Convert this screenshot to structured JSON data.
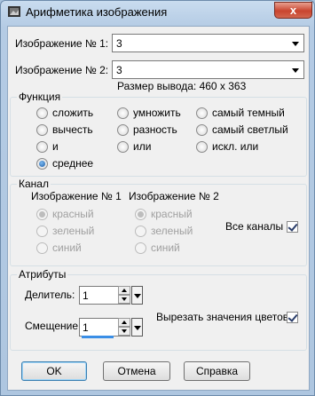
{
  "window": {
    "title": "Арифметика изображения",
    "close_glyph": "x"
  },
  "image1": {
    "label": "Изображение № 1:",
    "value": "3"
  },
  "image2": {
    "label": "Изображение № 2:",
    "value": "3"
  },
  "output_size": "Размер вывода: 460 x 363",
  "function": {
    "title": "Функция",
    "options": [
      {
        "label": "сложить",
        "selected": false
      },
      {
        "label": "умножить",
        "selected": false
      },
      {
        "label": "самый темный",
        "selected": false
      },
      {
        "label": "вычесть",
        "selected": false
      },
      {
        "label": "разность",
        "selected": false
      },
      {
        "label": "самый светлый",
        "selected": false
      },
      {
        "label": "и",
        "selected": false
      },
      {
        "label": "или",
        "selected": false
      },
      {
        "label": "искл. или",
        "selected": false
      },
      {
        "label": "среднее",
        "selected": true
      }
    ]
  },
  "channel": {
    "title": "Канал",
    "image1_label": "Изображение № 1",
    "image2_label": "Изображение № 2",
    "image1_options": [
      "красный",
      "зеленый",
      "синий"
    ],
    "image2_options": [
      "красный",
      "зеленый",
      "синий"
    ],
    "all_channels_label": "Все каналы",
    "all_channels_checked": true
  },
  "attributes": {
    "title": "Атрибуты",
    "divisor_label": "Делитель:",
    "divisor_value": "1",
    "offset_label": "Смещение:",
    "offset_value": "1",
    "clip_label": "Вырезать значения цветов",
    "clip_checked": true
  },
  "buttons": {
    "ok": "OK",
    "cancel": "Отмена",
    "help": "Справка"
  },
  "colors": {
    "accent": "#1f5fa8",
    "close": "#c9452f",
    "focus_bar": "#3a8ee6"
  }
}
